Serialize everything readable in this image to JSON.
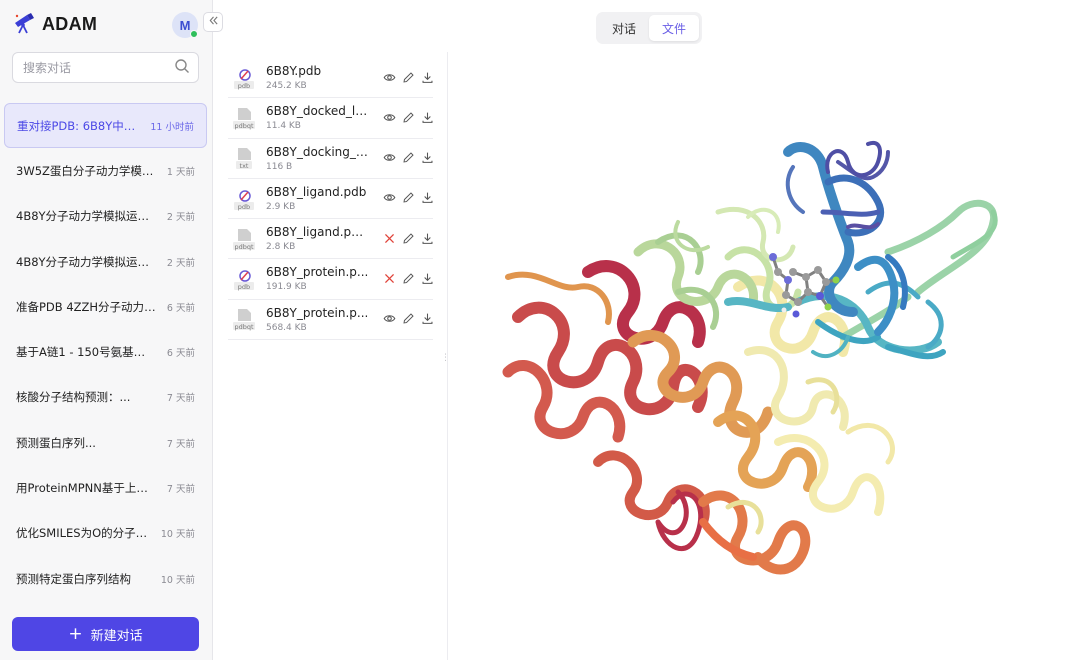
{
  "app": {
    "name": "ADAM",
    "avatar_letter": "M"
  },
  "search": {
    "placeholder": "搜索对话"
  },
  "chats": [
    {
      "title": "重对接PDB: 6B8Y中蛋...",
      "time": "11 小时前",
      "active": true
    },
    {
      "title": "3W5Z蛋白分子动力学模拟...",
      "time": "1 天前"
    },
    {
      "title": "4B8Y分子动力学模拟运行...",
      "time": "2 天前"
    },
    {
      "title": "4B8Y分子动力学模拟运行...",
      "time": "2 天前"
    },
    {
      "title": "准备PDB 4ZZH分子动力学...",
      "time": "6 天前"
    },
    {
      "title": "基于A链1 - 150号氨基酸及...",
      "time": "6 天前"
    },
    {
      "title": "核酸分子结构预测：...",
      "time": "7 天前"
    },
    {
      "title": "预测蛋白序列...",
      "time": "7 天前"
    },
    {
      "title": "用ProteinMPNN基于上传...",
      "time": "7 天前"
    },
    {
      "title": "优化SMILES为O的分子结...",
      "time": "10 天前"
    },
    {
      "title": "预测特定蛋白序列结构",
      "time": "10 天前"
    }
  ],
  "new_chat_label": "新建对话",
  "tabs": {
    "chat": "对话",
    "files": "文件",
    "active": "files"
  },
  "files": [
    {
      "name": "6B8Y.pdb",
      "size": "245.2 KB",
      "ext": "pdb",
      "viewable": true
    },
    {
      "name": "6B8Y_docked_li...",
      "size": "11.4 KB",
      "ext": "pdbqt",
      "viewable": true
    },
    {
      "name": "6B8Y_docking_l...",
      "size": "116 B",
      "ext": "txt",
      "viewable": true
    },
    {
      "name": "6B8Y_ligand.pdb",
      "size": "2.9 KB",
      "ext": "pdb",
      "viewable": true
    },
    {
      "name": "6B8Y_ligand.pd...",
      "size": "2.8 KB",
      "ext": "pdbqt",
      "viewable": false
    },
    {
      "name": "6B8Y_protein.p...",
      "size": "191.9 KB",
      "ext": "pdb",
      "viewable": false
    },
    {
      "name": "6B8Y_protein.p...",
      "size": "568.4 KB",
      "ext": "pdbqt",
      "viewable": true
    }
  ],
  "icons": {
    "logo": "telescope-icon",
    "search": "search-icon",
    "collapse": "chevrons-left-icon",
    "view": "eye-icon",
    "edit": "pencil-icon",
    "download": "download-icon",
    "no_view": "x-icon"
  },
  "colors": {
    "accent": "#4f46e5",
    "active_bg": "#e8e8fb",
    "online": "#2fbf5b",
    "no_view": "#e0443a"
  }
}
